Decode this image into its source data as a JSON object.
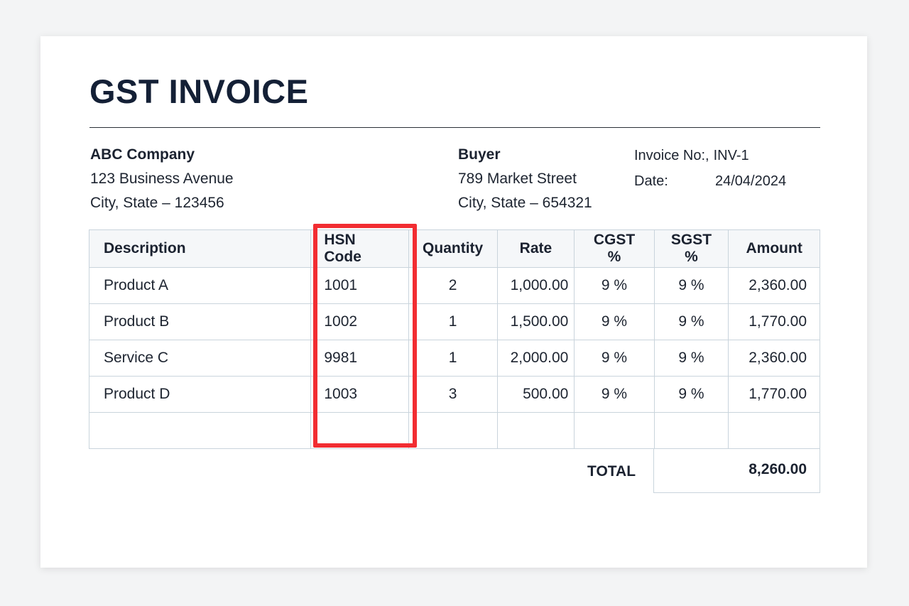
{
  "invoice": {
    "title": "GST INVOICE",
    "seller": {
      "name": "ABC Company",
      "address_line1": "123 Business Avenue",
      "address_line2": "City, State – 123456"
    },
    "buyer": {
      "name": "Buyer",
      "address_line1": "789 Market Street",
      "address_line2": "City, State – 654321"
    },
    "meta": {
      "invoice_no_label": "Invoice No:,",
      "invoice_no": "INV-1",
      "date_label": "Date:",
      "date": "24/04/2024"
    },
    "table": {
      "headers": {
        "description": "Description",
        "hsn": "HSN Code",
        "quantity": "Quantity",
        "rate": "Rate",
        "cgst": "CGST %",
        "sgst": "SGST %",
        "amount": "Amount"
      },
      "rows": [
        {
          "description": "Product A",
          "hsn": "1001",
          "quantity": "2",
          "rate": "1,000.00",
          "cgst": "9 %",
          "sgst": "9 %",
          "amount": "2,360.00"
        },
        {
          "description": "Product B",
          "hsn": "1002",
          "quantity": "1",
          "rate": "1,500.00",
          "cgst": "9 %",
          "sgst": "9 %",
          "amount": "1,770.00"
        },
        {
          "description": "Service C",
          "hsn": "9981",
          "quantity": "1",
          "rate": "2,000.00",
          "cgst": "9 %",
          "sgst": "9 %",
          "amount": "2,360.00"
        },
        {
          "description": "Product D",
          "hsn": "1003",
          "quantity": "3",
          "rate": "500.00",
          "cgst": "9 %",
          "sgst": "9 %",
          "amount": "1,770.00"
        }
      ]
    },
    "total": {
      "label": "TOTAL",
      "value": "8,260.00"
    }
  },
  "colors": {
    "highlight": "#f22d32",
    "title": "#142036",
    "border": "#c9d4dc"
  }
}
